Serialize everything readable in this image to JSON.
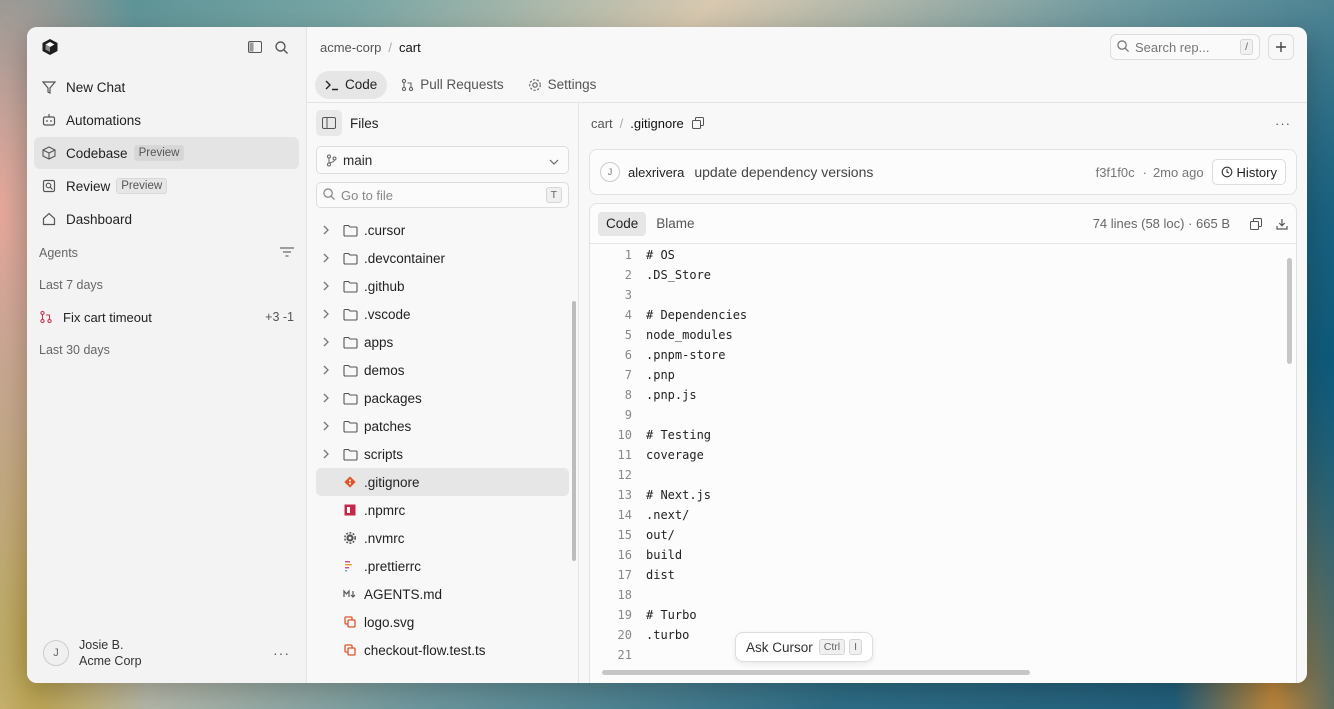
{
  "sidebar": {
    "nav": [
      {
        "label": "New Chat",
        "icon": "new-chat-icon"
      },
      {
        "label": "Automations",
        "icon": "automations-icon"
      },
      {
        "label": "Codebase",
        "badge": "Preview",
        "icon": "codebase-icon"
      },
      {
        "label": "Review",
        "badge": "Preview",
        "icon": "review-icon"
      },
      {
        "label": "Dashboard",
        "icon": "dashboard-icon"
      }
    ],
    "agents_label": "Agents",
    "last7": "Last 7 days",
    "agent_item": {
      "label": "Fix cart timeout",
      "diff": "+3 -1"
    },
    "last30": "Last 30 days",
    "user": {
      "initial": "J",
      "name": "Josie B.",
      "org": "Acme Corp"
    }
  },
  "topbar": {
    "org": "acme-corp",
    "repo": "cart",
    "search_placeholder": "Search rep...",
    "search_kbd": "/"
  },
  "tabs": [
    "Code",
    "Pull Requests",
    "Settings"
  ],
  "filetree": {
    "title": "Files",
    "branch": "main",
    "goto_placeholder": "Go to file",
    "goto_kbd": "T",
    "folders": [
      ".cursor",
      ".devcontainer",
      ".github",
      ".vscode",
      "apps",
      "demos",
      "packages",
      "patches",
      "scripts"
    ],
    "files": [
      {
        "name": ".gitignore",
        "icon": "git-icon",
        "color": "#e0542a"
      },
      {
        "name": ".npmrc",
        "icon": "npm-icon",
        "color": "#c6264a"
      },
      {
        "name": ".nvmrc",
        "icon": "gear-icon",
        "color": "#555555"
      },
      {
        "name": ".prettierrc",
        "icon": "prettier-icon",
        "color": "#c64aa0"
      },
      {
        "name": "AGENTS.md",
        "icon": "markdown-icon",
        "color": "#555555"
      },
      {
        "name": "logo.svg",
        "icon": "svg-icon",
        "color": "#e0542a"
      },
      {
        "name": "checkout-flow.test.ts",
        "icon": "test-icon",
        "color": "#e0542a"
      }
    ]
  },
  "codepanel": {
    "path_repo": "cart",
    "path_file": ".gitignore",
    "commit": {
      "initial": "J",
      "author": "alexrivera",
      "message": "update dependency versions",
      "sha": "f3f1f0c",
      "sep": "·",
      "age": "2mo ago",
      "history_label": "History"
    },
    "view_tabs": [
      "Code",
      "Blame"
    ],
    "info": "74 lines (58 loc) · 665 B",
    "lines": [
      "# OS",
      ".DS_Store",
      "",
      "# Dependencies",
      "node_modules",
      ".pnpm-store",
      ".pnp",
      ".pnp.js",
      "",
      "# Testing",
      "coverage",
      "",
      "# Next.js",
      ".next/",
      "out/",
      "build",
      "dist",
      "",
      "# Turbo",
      ".turbo",
      ""
    ]
  },
  "ask": {
    "label": "Ask Cursor",
    "kbd1": "Ctrl",
    "kbd2": "I"
  }
}
